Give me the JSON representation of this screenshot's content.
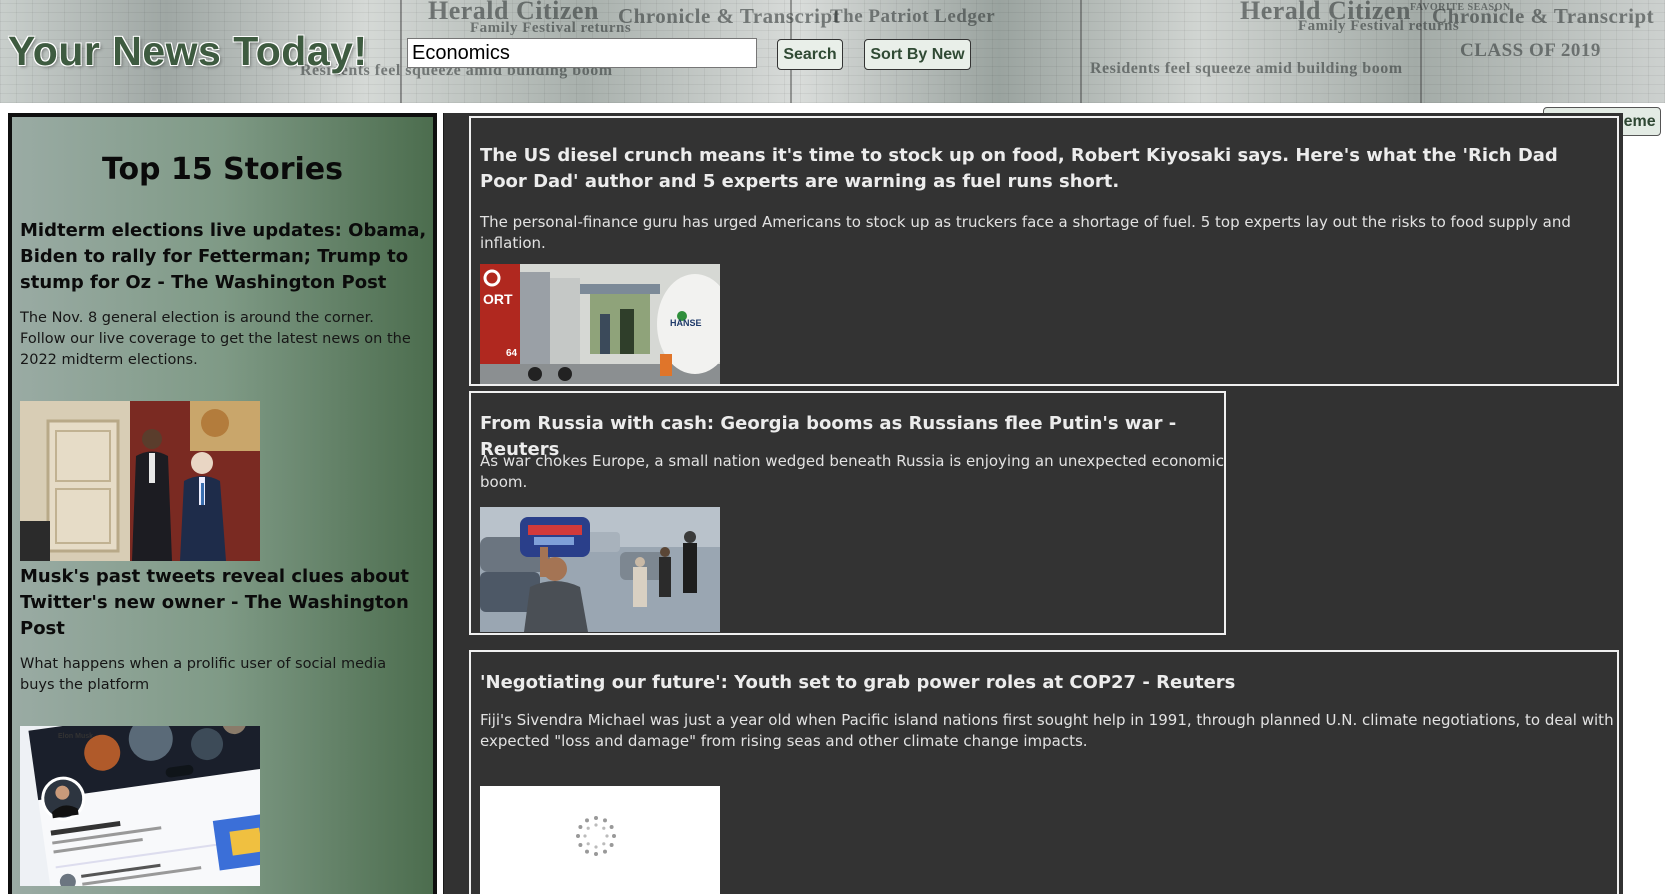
{
  "header": {
    "site_title": "Your News Today!",
    "search_value": "Economics",
    "search_button": "Search",
    "sort_button": "Sort By New",
    "background_paper_text": [
      "Herald Citizen",
      "Family Festival returns",
      "Chronicle & Transcript",
      "The Patriot Ledger",
      "Residents feel squeeze amid building boom",
      "CLASS OF 2019",
      "FAVORITE SEASON"
    ]
  },
  "toggle_theme_label": "Toggle Theme",
  "sidebar": {
    "title": "Top 15 Stories",
    "stories": [
      {
        "headline": "Midterm elections live updates: Obama, Biden to rally for Fetterman; Trump to stump for Oz - The Washington Post",
        "description": "The Nov. 8 general election is around the corner. Follow our live coverage to get the latest news on the 2022 midterm elections.",
        "image_icon": "obama-biden-photo-icon"
      },
      {
        "headline": "Musk's past tweets reveal clues about Twitter's new owner - The Washington Post",
        "description": "What happens when a prolific user of social media buys the platform",
        "image_icon": "twitter-profile-photo-icon",
        "image_caption": "Elon Musk"
      }
    ]
  },
  "feed": {
    "articles": [
      {
        "headline": "The US diesel crunch means it's time to stock up on food, Robert Kiyosaki says. Here's what the 'Rich Dad Poor Dad' author and 5 experts are warning as fuel runs short.",
        "description": "The personal-finance guru has urged Americans to stock up as truckers face a shortage of fuel. 5 top experts lay out the risks to food supply and inflation.",
        "image_icon": "fuel-trucks-photo-icon",
        "image_text": [
          "ORT",
          "HANSE",
          "64"
        ]
      },
      {
        "headline": "From Russia with cash: Georgia booms as Russians flee Putin's war - Reuters",
        "description": "As war chokes Europe, a small nation wedged beneath Russia is enjoying an unexpected economic boom.",
        "image_icon": "man-carrying-bag-photo-icon"
      },
      {
        "headline": "'Negotiating our future': Youth set to grab power roles at COP27 - Reuters",
        "description": "Fiji's Sivendra Michael was just a year old when Pacific island nations first sought help in 1991, through planned U.N. climate negotiations, to deal with expected \"loss and damage\" from rising seas and other climate change impacts.",
        "image_icon": "loading-spinner-icon"
      }
    ]
  },
  "colors": {
    "title_green": "#3e5b40",
    "feed_bg": "#323232",
    "card_border": "#f0f0f0",
    "sidebar_gradient_start": "#9aaba4",
    "sidebar_gradient_end": "#4c6d4e"
  }
}
